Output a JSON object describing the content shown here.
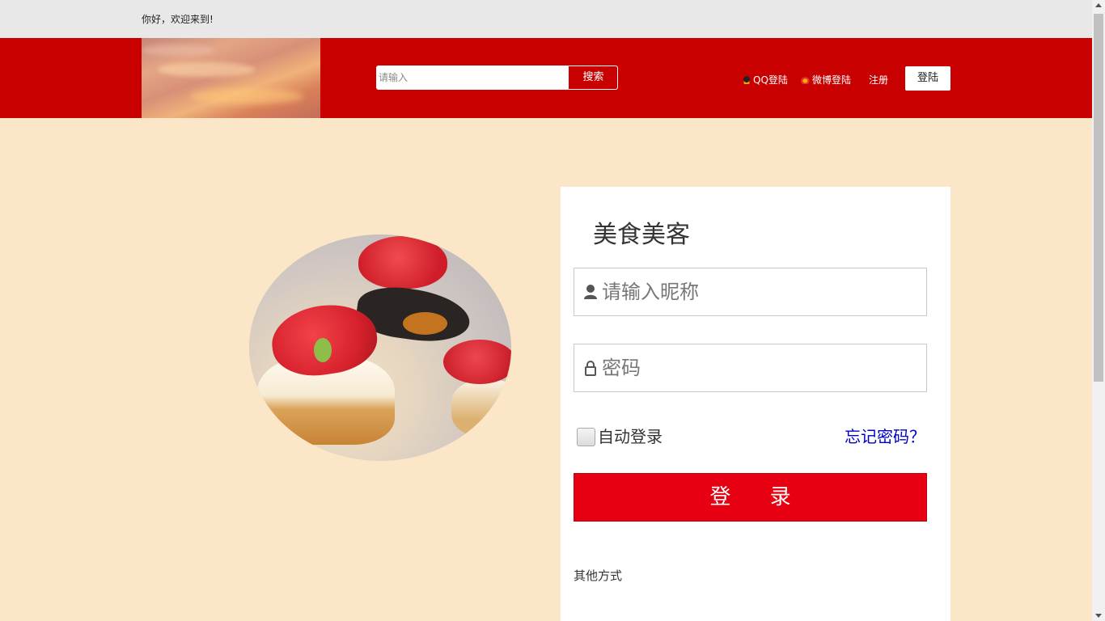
{
  "topbar": {
    "welcome": "你好，欢迎来到!"
  },
  "header": {
    "search_placeholder": "请输入",
    "search_button": "搜索",
    "qq_login": "QQ登陆",
    "weibo_login": "微博登陆",
    "register": "注册",
    "login": "登陆"
  },
  "panel": {
    "title": "美食美客",
    "nickname_placeholder": "请输入昵称",
    "password_placeholder": "密码",
    "auto_login": "自动登录",
    "forgot_password": "忘记密码？",
    "submit": "登 录",
    "other_methods": "其他方式"
  },
  "colors": {
    "brand_red": "#c80000",
    "button_red": "#e60012",
    "page_bg": "#fbe7c8",
    "link_blue": "#0000c8"
  }
}
